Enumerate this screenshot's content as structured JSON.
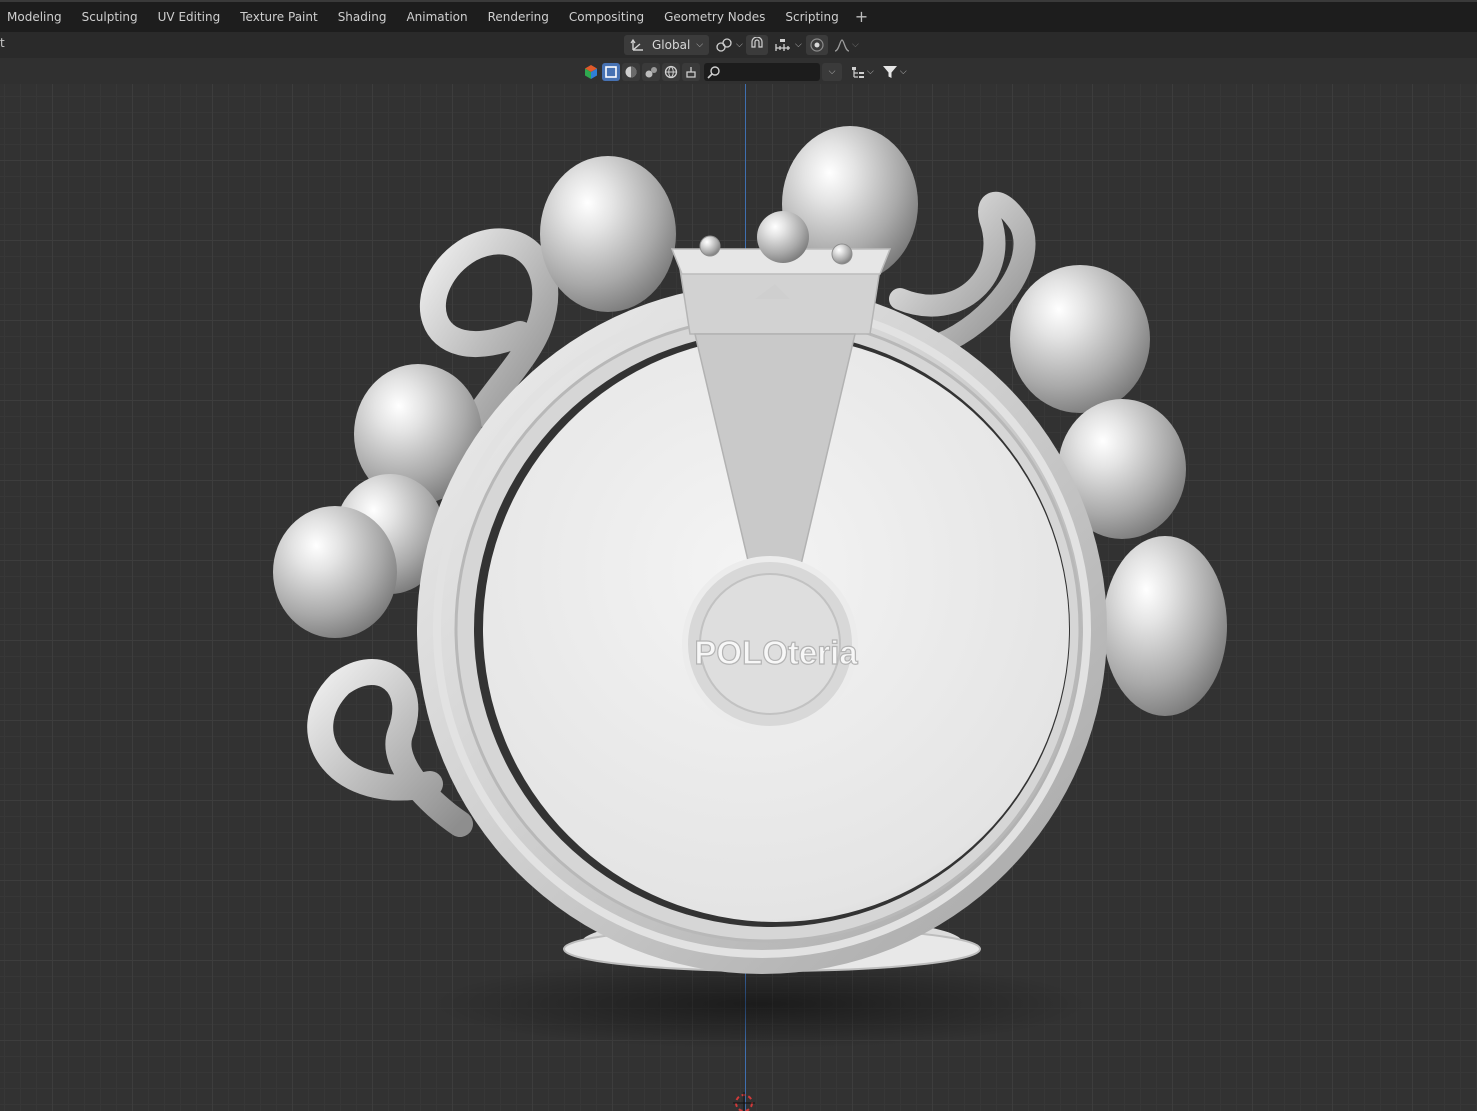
{
  "workspace_tabs": [
    "Modeling",
    "Sculpting",
    "UV Editing",
    "Texture Paint",
    "Shading",
    "Animation",
    "Rendering",
    "Compositing",
    "Geometry Nodes",
    "Scripting"
  ],
  "add_tab_label": "+",
  "header": {
    "left_fragment": "t",
    "orientation_label": "Global"
  },
  "icons": {
    "orientation": "transform-orientation-icon",
    "pivot": "pivot-point-icon",
    "snap": "snap-magnet-icon",
    "snap_target": "snap-increment-icon",
    "proportional": "proportional-edit-icon",
    "falloff": "falloff-curve-icon",
    "search": "search-icon",
    "filter": "filter-icon"
  },
  "accent_color": "#4772b3",
  "viewport": {
    "object_logo_text": "POLOteria",
    "axis_color": "#3f6fb0"
  }
}
